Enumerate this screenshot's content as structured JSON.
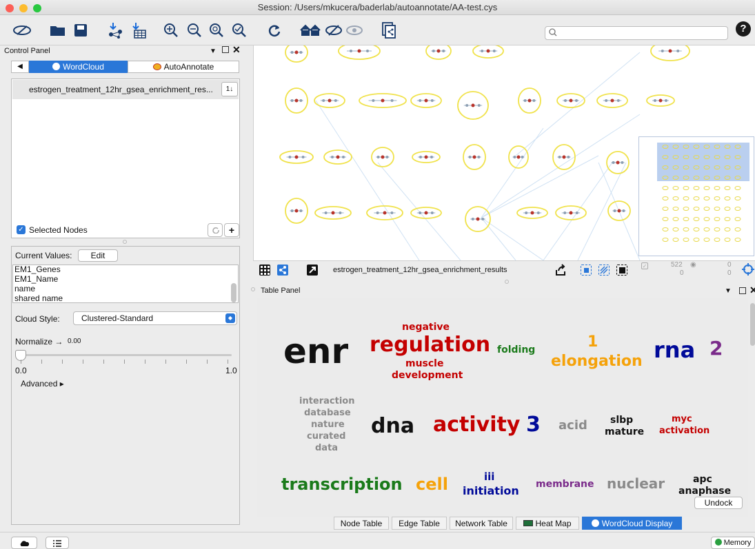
{
  "window": {
    "title": "Session: /Users/mkucera/baderlab/autoannotate/AA-test.cys"
  },
  "toolbar": {
    "icons": [
      "eye-slash-icon",
      "folder-open-icon",
      "save-icon",
      "import-network-icon",
      "import-table-icon",
      "zoom-in-icon",
      "zoom-out-icon",
      "zoom-fit-icon",
      "zoom-selected-icon",
      "refresh-icon",
      "home-icon",
      "hide-icon",
      "show-icon",
      "export-icon"
    ],
    "search_placeholder": "",
    "help": "?"
  },
  "control_panel": {
    "title": "Control Panel",
    "tabs": [
      "WordCloud",
      "AutoAnnotate"
    ],
    "wordcloud_list": [
      "estrogen_treatment_12hr_gsea_enrichment_res..."
    ],
    "sort_glyph": "1↓",
    "selected_nodes_label": "Selected Nodes",
    "add_glyph": "+",
    "current_values_label": "Current Values:",
    "edit_label": "Edit",
    "attributes": [
      "EM1_Genes",
      "EM1_Name",
      "name",
      "shared name"
    ],
    "cloud_style_label": "Cloud Style:",
    "cloud_style_value": "Clustered-Standard",
    "normalize_label": "Normalize →",
    "normalize_value": "0.00",
    "slider_min": "0.0",
    "slider_max": "1.0",
    "slider_fraction": 0.0,
    "advanced_label": "Advanced ▸"
  },
  "network": {
    "name": "estrogen_treatment_12hr_gsea_enrichment_results",
    "node_count": "522",
    "edge_count": "0",
    "sub1": "0",
    "sub2": "0"
  },
  "table_panel": {
    "title": "Table Panel",
    "undock_label": "Undock",
    "tabs": [
      "Node Table",
      "Edge Table",
      "Network Table",
      "Heat Map",
      "WordCloud Display"
    ]
  },
  "cloud_words": {
    "enr": "enr",
    "negative": "negative",
    "regulation": "regulation",
    "muscle": "muscle",
    "development": "development",
    "folding": "folding",
    "one": "1",
    "elongation": "elongation",
    "rna": "rna",
    "two": "2",
    "interaction": "interaction",
    "database": "database",
    "nature": "nature",
    "curated": "curated",
    "data": "data",
    "dna": "dna",
    "activity": "activity",
    "three": "3",
    "acid": "acid",
    "slbp": "slbp",
    "mature": "mature",
    "myc": "myc",
    "activation": "activation",
    "transcription": "transcription",
    "cell": "cell",
    "iii": "iii",
    "initiation": "initiation",
    "membrane": "membrane",
    "nuclear": "nuclear",
    "apc": "apc",
    "anaphase": "anaphase"
  },
  "status": {
    "memory_label": "Memory"
  },
  "colors": {
    "accent": "#2a77d8",
    "black": "#111111",
    "red": "#c40000",
    "green": "#1a7a1a",
    "orange": "#f5a20a",
    "navy": "#000a99",
    "purple": "#7a2a8a",
    "gray": "#8a8a8a"
  }
}
